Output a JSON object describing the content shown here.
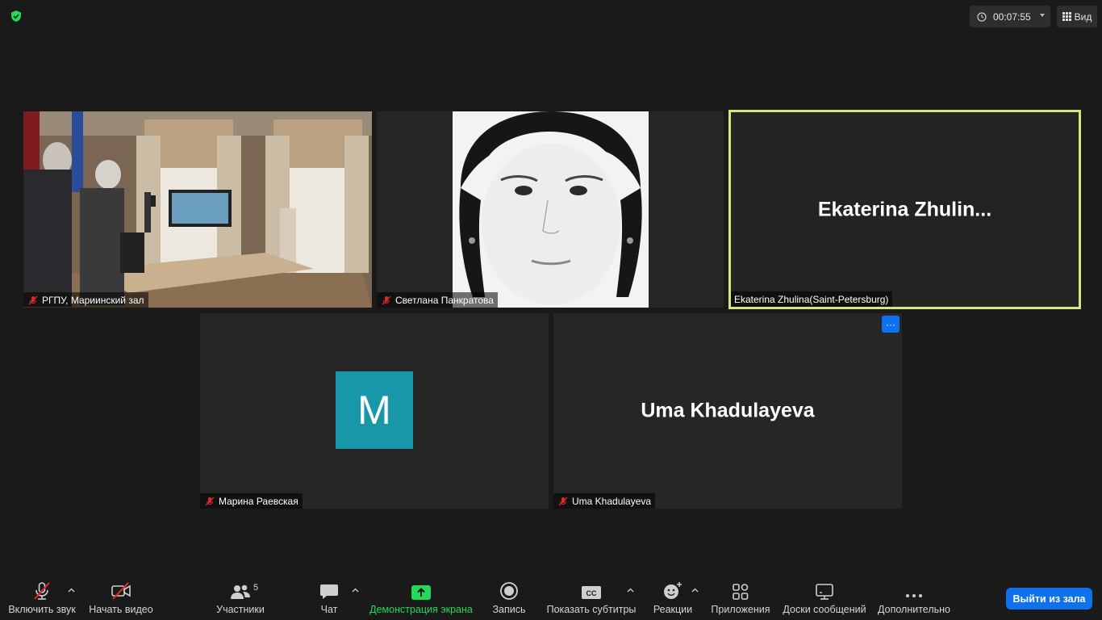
{
  "top_bar": {
    "timer": "00:07:55",
    "view_label": "Вид"
  },
  "participants": [
    {
      "name": "РГПУ, Мариинский зал",
      "muted": true,
      "video": true
    },
    {
      "name": "Светлана Панкратова",
      "muted": true,
      "video": true
    },
    {
      "name": "Ekaterina Zhulina(Saint-Petersburg)",
      "display_name": "Ekaterina  Zhulin...",
      "muted": false,
      "video": false,
      "active_speaker": true
    },
    {
      "name": "Марина Раевская",
      "avatar_letter": "M",
      "muted": true,
      "video": false
    },
    {
      "name": "Uma Khadulayeva",
      "display_name": "Uma Khadulayeva",
      "muted": true,
      "video": false
    }
  ],
  "more_options_glyph": "···",
  "toolbar": {
    "unmute": "Включить звук",
    "start_video": "Начать видео",
    "participants": "Участники",
    "participants_count": "5",
    "chat": "Чат",
    "share_screen": "Демонстрация экрана",
    "record": "Запись",
    "captions": "Показать субтитры",
    "reactions": "Реакции",
    "apps": "Приложения",
    "whiteboards": "Доски сообщений",
    "more": "Дополнительно",
    "leave": "Выйти из зала"
  },
  "colors": {
    "background": "#1a1a1a",
    "active_speaker_border": "#d7e67a",
    "share_green": "#23d959",
    "leave_blue": "#0e72ed",
    "avatar_teal": "#1797a8",
    "muted_red": "#e02828"
  }
}
